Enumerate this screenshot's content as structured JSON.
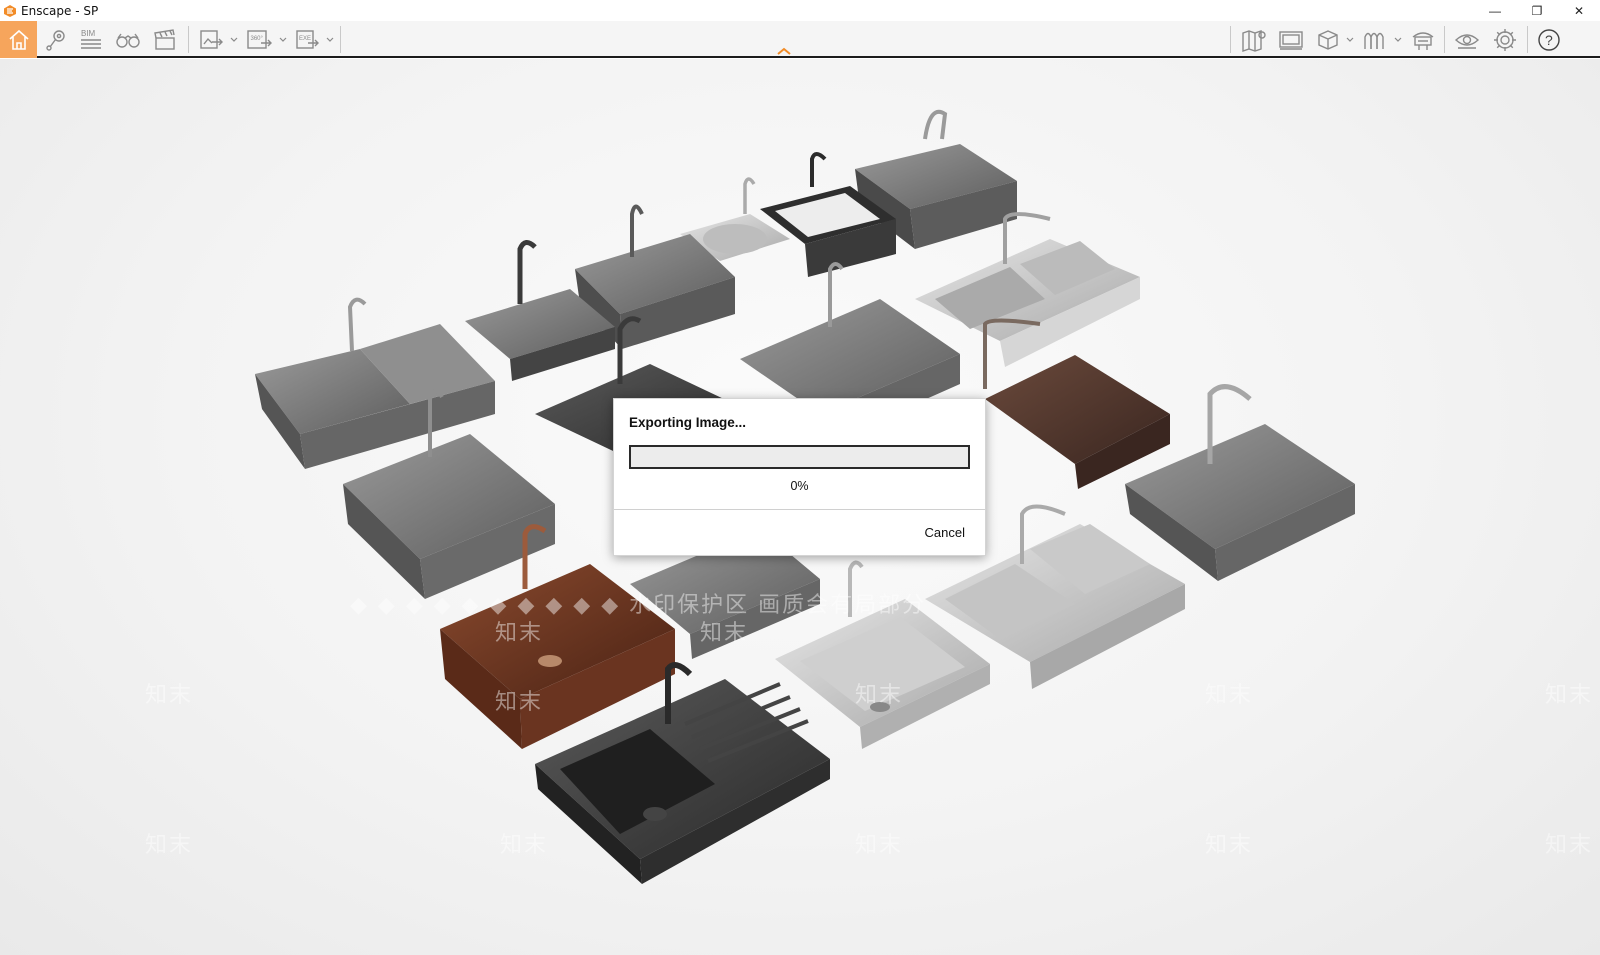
{
  "window": {
    "title": "Enscape - SP",
    "controls": {
      "minimize": "—",
      "restore": "❐",
      "close": "✕"
    }
  },
  "toolbar": {
    "left_tools": [
      {
        "name": "home",
        "icon": "home-icon",
        "active": true
      },
      {
        "name": "views",
        "icon": "location-pin-icon"
      },
      {
        "name": "bim",
        "icon": "bim-icon",
        "label": "BIM"
      },
      {
        "name": "walk-mode",
        "icon": "binoculars-icon"
      },
      {
        "name": "video-editor",
        "icon": "clapperboard-icon"
      },
      {
        "name": "render-image",
        "icon": "export-image-icon"
      },
      {
        "name": "render-panorama",
        "icon": "panorama-icon",
        "label": "360°"
      },
      {
        "name": "export-exe",
        "icon": "exe-export-icon",
        "label": "EXE"
      }
    ],
    "right_tools": [
      {
        "name": "map",
        "icon": "map-icon"
      },
      {
        "name": "batch-render",
        "icon": "batch-render-icon"
      },
      {
        "name": "asset-library",
        "icon": "cube-icon"
      },
      {
        "name": "material-editor",
        "icon": "arches-icon"
      },
      {
        "name": "atmosphere",
        "icon": "atmosphere-icon"
      },
      {
        "name": "visual-settings",
        "icon": "eye-icon"
      },
      {
        "name": "general-settings",
        "icon": "gear-icon"
      },
      {
        "name": "help",
        "icon": "help-icon",
        "label": "?"
      }
    ],
    "accent_color": "#f6a55c"
  },
  "watermarks": {
    "banner": "◆ ◆ ◆ ◆ ◆ ◆ ◆ ◆ ◆ ◆ 水印保护区  画质会有局部分",
    "tiles": [
      "知末",
      "知末",
      "知末",
      "知末",
      "知末",
      "知末",
      "知末",
      "知末",
      "知末",
      "知末",
      "知末",
      "知末"
    ]
  },
  "dialog": {
    "title": "Exporting Image...",
    "progress": 0,
    "progress_label": "0%",
    "cancel_label": "Cancel"
  }
}
